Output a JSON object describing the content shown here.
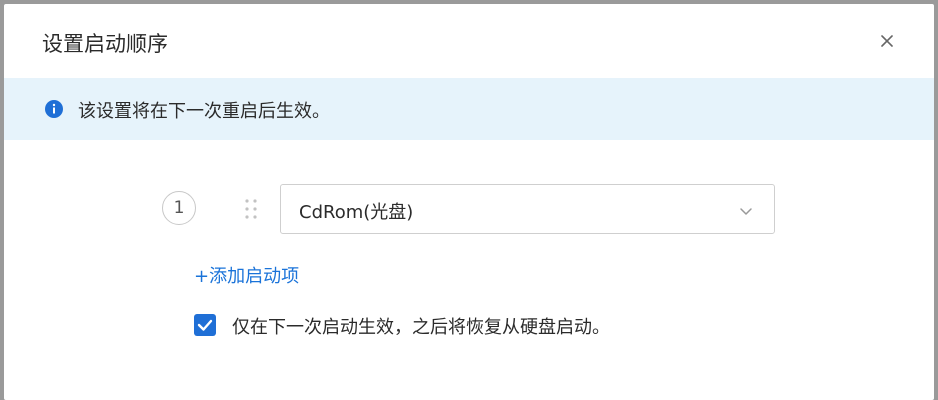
{
  "dialog": {
    "title": "设置启动顺序",
    "close_icon": "close-icon"
  },
  "notice": {
    "icon": "info-icon",
    "text": "该设置将在下一次重启后生效。",
    "background_color": "#e6f3fb",
    "icon_color": "#1f6fd6"
  },
  "boot_order": {
    "items": [
      {
        "index": "1",
        "value": "CdRom(光盘)"
      }
    ],
    "add_label": "+添加启动项"
  },
  "once_option": {
    "checked": true,
    "label": "仅在下一次启动生效，之后将恢复从硬盘启动。"
  },
  "colors": {
    "accent": "#1f6fd6",
    "link": "#1a73d9"
  }
}
